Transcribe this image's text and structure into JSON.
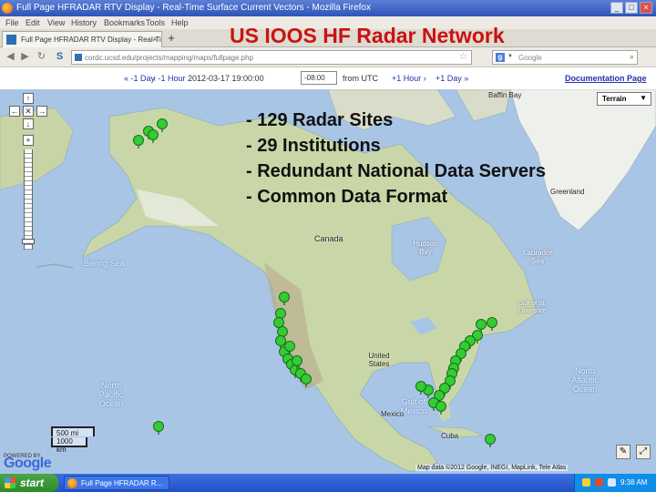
{
  "window": {
    "title": "Full Page HFRADAR RTV Display - Real-Time Surface Current Vectors - Mozilla Firefox",
    "buttons": [
      "_",
      "□",
      "×"
    ]
  },
  "menu": [
    "File",
    "Edit",
    "View",
    "History",
    "Bookmarks",
    "Tools",
    "Help"
  ],
  "tab": {
    "label": "Full Page HFRADAR RTV Display - Real-Time ...",
    "close": "×",
    "new": "+"
  },
  "slide": {
    "title": "US IOOS HF Radar Network",
    "bullets": [
      "- 129 Radar Sites",
      "- 29 Institutions",
      "- Redundant National Data Servers",
      "- Common Data Format"
    ]
  },
  "nav": {
    "url": "cordc.ucsd.edu/projects/mapping/maps/fullpage.php",
    "search_placeholder": "Google",
    "search_engine_letter": "g"
  },
  "pagebar": {
    "prev_day": "« -1 Day",
    "prev_hour": "‹ -1 Hour",
    "datetime": "2012-03-17 19:00:00",
    "timezone": "-08:00",
    "from_utc": "from UTC",
    "next_hour": "+1 Hour ›",
    "next_day": "+1 Day »",
    "documentation": "Documentation Page"
  },
  "map": {
    "map_type": "Terrain",
    "labels": {
      "baffin_bay": "Baffin Bay",
      "greenland": "Greenland",
      "canada": "Canada",
      "hudson_bay": "Hudson Bay",
      "bering_sea": "Bering Sea",
      "labrador_sea": "Labrador Sea",
      "united_states": "United States",
      "gulf_of_st_lawrence": "Gulf of St. Lawrence",
      "gulf_of_mexico": "Gulf of Mexico",
      "mexico": "Mexico",
      "cuba": "Cuba",
      "north_pacific": "North Pacific Ocean",
      "north_atlantic": "North Atlantic Ocean"
    },
    "scale": {
      "miles": "500 mi",
      "km": "1000 km"
    },
    "powered_by": "POWERED BY",
    "logo": "Google",
    "attribution": "Map data ©2012 Google, INEGI, MapLink, Tele Atlas"
  },
  "taskbar": {
    "start": "start",
    "task": "Full Page HFRADAR R...",
    "clock": "9:38 AM"
  },
  "colors": {
    "heading_red": "#cc1111",
    "marker_green": "#33cc33",
    "ocean": "#a8c5e6",
    "land": "#c9d7a8"
  }
}
